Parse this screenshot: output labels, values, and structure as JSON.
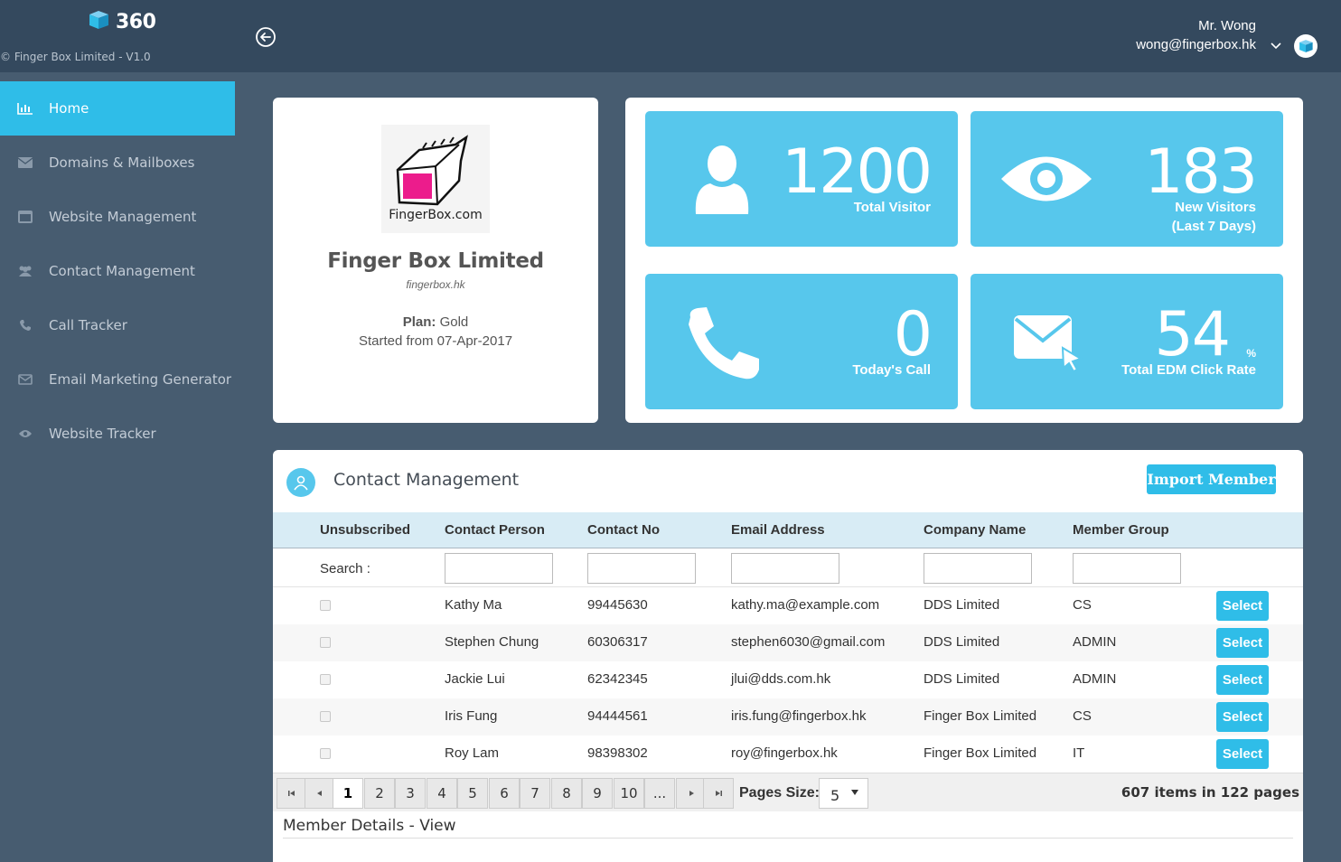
{
  "header": {
    "brand": "360",
    "copyright": "© Finger Box Limited - V1.0",
    "user_name": "Mr. Wong",
    "user_email": "wong@fingerbox.hk"
  },
  "sidebar": {
    "items": [
      {
        "label": "Home",
        "icon": "bar-chart-icon"
      },
      {
        "label": "Domains & Mailboxes",
        "icon": "envelope-icon"
      },
      {
        "label": "Website Management",
        "icon": "window-icon"
      },
      {
        "label": "Contact Management",
        "icon": "users-icon"
      },
      {
        "label": "Call Tracker",
        "icon": "phone-icon"
      },
      {
        "label": "Email Marketing Generator",
        "icon": "envelope-outline-icon"
      },
      {
        "label": "Website Tracker",
        "icon": "eye-icon"
      }
    ]
  },
  "company": {
    "logo_text": "FingerBox.com",
    "name": "Finger Box Limited",
    "domain": "fingerbox.hk",
    "plan_label": "Plan:",
    "plan_value": "Gold",
    "started": "Started from 07-Apr-2017"
  },
  "stats": {
    "visitors": {
      "value": "1200",
      "label": "Total Visitor"
    },
    "new_visitors": {
      "value": "183",
      "label1": "New Visitors",
      "label2": "(Last 7 Days)"
    },
    "calls": {
      "value": "0",
      "label": "Today's Call"
    },
    "edm": {
      "value": "54",
      "unit": "%",
      "label": "Total EDM Click Rate"
    }
  },
  "contacts": {
    "title": "Contact Management",
    "import_label": "Import Member",
    "columns": [
      "Unsubscribed",
      "Contact Person",
      "Contact No",
      "Email Address",
      "Company Name",
      "Member Group"
    ],
    "search_label": "Search :",
    "select_label": "Select",
    "rows": [
      {
        "person": "Kathy Ma",
        "phone": "99445630",
        "email": "kathy.ma@example.com",
        "company": "DDS Limited",
        "group": "CS"
      },
      {
        "person": "Stephen Chung",
        "phone": "60306317",
        "email": "stephen6030@gmail.com",
        "company": "DDS Limited",
        "group": "ADMIN"
      },
      {
        "person": "Jackie Lui",
        "phone": "62342345",
        "email": "jlui@dds.com.hk",
        "company": "DDS Limited",
        "group": "ADMIN"
      },
      {
        "person": "Iris Fung",
        "phone": "94444561",
        "email": "iris.fung@fingerbox.hk",
        "company": "Finger Box Limited",
        "group": "CS"
      },
      {
        "person": "Roy Lam",
        "phone": "98398302",
        "email": "roy@fingerbox.hk",
        "company": "Finger Box Limited",
        "group": "IT"
      }
    ]
  },
  "pager": {
    "pages": [
      "1",
      "2",
      "3",
      "4",
      "5",
      "6",
      "7",
      "8",
      "9",
      "10",
      "..."
    ],
    "current": "1",
    "size_label": "Pages Size:",
    "size_value": "5",
    "info": "607 items in 122 pages"
  },
  "details": {
    "title": "Member Details - View"
  },
  "colors": {
    "accent": "#2fbde8",
    "tile": "#57c7ec",
    "topbar": "#34495e",
    "background": "#475c70"
  }
}
